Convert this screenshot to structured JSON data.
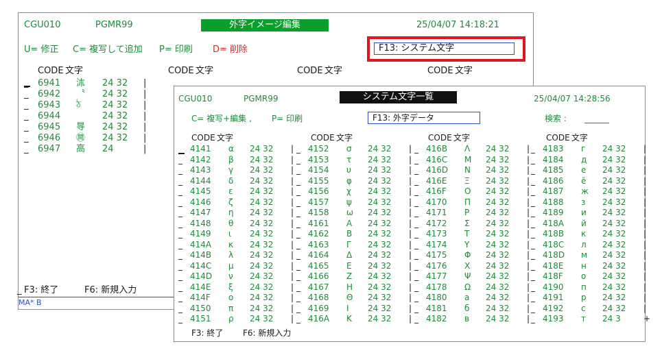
{
  "back": {
    "program_id": "CGU010",
    "user_id": "PGMR99",
    "title": "外字イメージ編集",
    "datetime": "25/04/07  14:18:21",
    "cmd_modify": "U= 修正",
    "cmd_copy_add": "C= 複写して追加",
    "cmd_print": "P= 印刷",
    "cmd_delete": "D= 削除",
    "f13_label": "F13: システム文字",
    "col_code": "CODE",
    "col_char": "文字",
    "rows": [
      {
        "code": "6941",
        "char": "㳈",
        "size": "24 32",
        "sep": "|"
      },
      {
        "code": "6942",
        "char": "〝",
        "size": "24 32",
        "sep": "|"
      },
      {
        "code": "6943",
        "char": "ঠ",
        "size": "24 32",
        "sep": "|"
      },
      {
        "code": "6944",
        "char": "",
        "size": "24 32",
        "sep": "|"
      },
      {
        "code": "6945",
        "char": "㝵",
        "size": "24 32",
        "sep": "|"
      },
      {
        "code": "6946",
        "char": "㉄",
        "size": "24 32",
        "sep": "|"
      },
      {
        "code": "6947",
        "char": "高",
        "size": "24",
        "sep": "|"
      }
    ],
    "footer_f3": "F3: 終了",
    "footer_f6": "F6: 新規入力",
    "status_text": "MA*     B"
  },
  "front": {
    "program_id": "CGU010",
    "user_id": "PGMR99",
    "title": "システム文字一覧",
    "datetime": "25/04/07  14:28:56",
    "cmd_copy_edit": "C= 複写+編集 ,",
    "cmd_print": "P= 印刷",
    "f13_label": "F13: 外字データ",
    "search_label": "検索 :",
    "col_code": "CODE",
    "col_char": "文字",
    "columns": [
      [
        {
          "code": "4141",
          "char": "α",
          "size": "24 32",
          "sep": "|"
        },
        {
          "code": "4142",
          "char": "β",
          "size": "24 32",
          "sep": "|"
        },
        {
          "code": "4143",
          "char": "γ",
          "size": "24 32",
          "sep": "|"
        },
        {
          "code": "4144",
          "char": "δ",
          "size": "24 32",
          "sep": "|"
        },
        {
          "code": "4145",
          "char": "ε",
          "size": "24 32",
          "sep": "|"
        },
        {
          "code": "4146",
          "char": "ζ",
          "size": "24 32",
          "sep": "|"
        },
        {
          "code": "4147",
          "char": "η",
          "size": "24 32",
          "sep": "|"
        },
        {
          "code": "4148",
          "char": "θ",
          "size": "24 32",
          "sep": "|"
        },
        {
          "code": "4149",
          "char": "ι",
          "size": "24 32",
          "sep": "|"
        },
        {
          "code": "414A",
          "char": "κ",
          "size": "24 32",
          "sep": "|"
        },
        {
          "code": "414B",
          "char": "λ",
          "size": "24 32",
          "sep": "|"
        },
        {
          "code": "414C",
          "char": "μ",
          "size": "24 32",
          "sep": "|"
        },
        {
          "code": "414D",
          "char": "ν",
          "size": "24 32",
          "sep": "|"
        },
        {
          "code": "414E",
          "char": "ξ",
          "size": "24 32",
          "sep": "|"
        },
        {
          "code": "414F",
          "char": "ο",
          "size": "24 32",
          "sep": "|"
        },
        {
          "code": "4150",
          "char": "π",
          "size": "24 32",
          "sep": "|"
        },
        {
          "code": "4151",
          "char": "ρ",
          "size": "24 32",
          "sep": "|"
        }
      ],
      [
        {
          "code": "4152",
          "char": "σ",
          "size": "24 32",
          "sep": "|"
        },
        {
          "code": "4153",
          "char": "τ",
          "size": "24 32",
          "sep": "|"
        },
        {
          "code": "4154",
          "char": "υ",
          "size": "24 32",
          "sep": "|"
        },
        {
          "code": "4155",
          "char": "φ",
          "size": "24 32",
          "sep": "|"
        },
        {
          "code": "4156",
          "char": "χ",
          "size": "24 32",
          "sep": "|"
        },
        {
          "code": "4157",
          "char": "ψ",
          "size": "24 32",
          "sep": "|"
        },
        {
          "code": "4158",
          "char": "ω",
          "size": "24 32",
          "sep": "|"
        },
        {
          "code": "4161",
          "char": "A",
          "size": "24 32",
          "sep": "|"
        },
        {
          "code": "4162",
          "char": "B",
          "size": "24 32",
          "sep": "|"
        },
        {
          "code": "4163",
          "char": "Γ",
          "size": "24 32",
          "sep": "|"
        },
        {
          "code": "4164",
          "char": "Δ",
          "size": "24 32",
          "sep": "|"
        },
        {
          "code": "4165",
          "char": "E",
          "size": "24 32",
          "sep": "|"
        },
        {
          "code": "4166",
          "char": "Z",
          "size": "24 32",
          "sep": "|"
        },
        {
          "code": "4167",
          "char": "H",
          "size": "24 32",
          "sep": "|"
        },
        {
          "code": "4168",
          "char": "Θ",
          "size": "24 32",
          "sep": "|"
        },
        {
          "code": "4169",
          "char": "I",
          "size": "24 32",
          "sep": "|"
        },
        {
          "code": "416A",
          "char": "K",
          "size": "24 32",
          "sep": "|"
        }
      ],
      [
        {
          "code": "416B",
          "char": "Λ",
          "size": "24 32",
          "sep": "|"
        },
        {
          "code": "416C",
          "char": "M",
          "size": "24 32",
          "sep": "|"
        },
        {
          "code": "416D",
          "char": "N",
          "size": "24 32",
          "sep": "|"
        },
        {
          "code": "416E",
          "char": "Ξ",
          "size": "24 32",
          "sep": "|"
        },
        {
          "code": "416F",
          "char": "O",
          "size": "24 32",
          "sep": "|"
        },
        {
          "code": "4170",
          "char": "Π",
          "size": "24 32",
          "sep": "|"
        },
        {
          "code": "4171",
          "char": "P",
          "size": "24 32",
          "sep": "|"
        },
        {
          "code": "4172",
          "char": "Σ",
          "size": "24 32",
          "sep": "|"
        },
        {
          "code": "4173",
          "char": "T",
          "size": "24 32",
          "sep": "|"
        },
        {
          "code": "4174",
          "char": "Y",
          "size": "24 32",
          "sep": "|"
        },
        {
          "code": "4175",
          "char": "Φ",
          "size": "24 32",
          "sep": "|"
        },
        {
          "code": "4176",
          "char": "X",
          "size": "24 32",
          "sep": "|"
        },
        {
          "code": "4177",
          "char": "Ψ",
          "size": "24 32",
          "sep": "|"
        },
        {
          "code": "4178",
          "char": "Ω",
          "size": "24 32",
          "sep": "|"
        },
        {
          "code": "4180",
          "char": "а",
          "size": "24 32",
          "sep": "|"
        },
        {
          "code": "4181",
          "char": "б",
          "size": "24 32",
          "sep": "|"
        },
        {
          "code": "4182",
          "char": "в",
          "size": "24 32",
          "sep": "|"
        }
      ],
      [
        {
          "code": "4183",
          "char": "г",
          "size": "24 32",
          "sep": "|"
        },
        {
          "code": "4184",
          "char": "д",
          "size": "24 32",
          "sep": "|"
        },
        {
          "code": "4185",
          "char": "е",
          "size": "24 32",
          "sep": "|"
        },
        {
          "code": "4186",
          "char": "ё",
          "size": "24 32",
          "sep": "|"
        },
        {
          "code": "4187",
          "char": "ж",
          "size": "24 32",
          "sep": "|"
        },
        {
          "code": "4188",
          "char": "з",
          "size": "24 32",
          "sep": "|"
        },
        {
          "code": "4189",
          "char": "и",
          "size": "24 32",
          "sep": "|"
        },
        {
          "code": "418A",
          "char": "й",
          "size": "24 32",
          "sep": "|"
        },
        {
          "code": "418B",
          "char": "к",
          "size": "24 32",
          "sep": "|"
        },
        {
          "code": "418C",
          "char": "л",
          "size": "24 32",
          "sep": "|"
        },
        {
          "code": "418D",
          "char": "м",
          "size": "24 32",
          "sep": "|"
        },
        {
          "code": "418E",
          "char": "н",
          "size": "24 32",
          "sep": "|"
        },
        {
          "code": "418F",
          "char": "о",
          "size": "24 32",
          "sep": "|"
        },
        {
          "code": "4190",
          "char": "п",
          "size": "24 32",
          "sep": "|"
        },
        {
          "code": "4191",
          "char": "р",
          "size": "24 32",
          "sep": "|"
        },
        {
          "code": "4192",
          "char": "с",
          "size": "24 32",
          "sep": "|"
        },
        {
          "code": "4193",
          "char": "т",
          "size": "24 3",
          "sep": "+"
        }
      ]
    ],
    "footer_f3": "F3: 終了",
    "footer_f6": "F6: 新規入力"
  },
  "colors": {
    "text_green": "#1f8a3a",
    "text_blue": "#2a4fc2",
    "delete_red": "#d8262a",
    "highlight_red": "#e0161e",
    "title_green_bg": "#0a9e2a"
  }
}
